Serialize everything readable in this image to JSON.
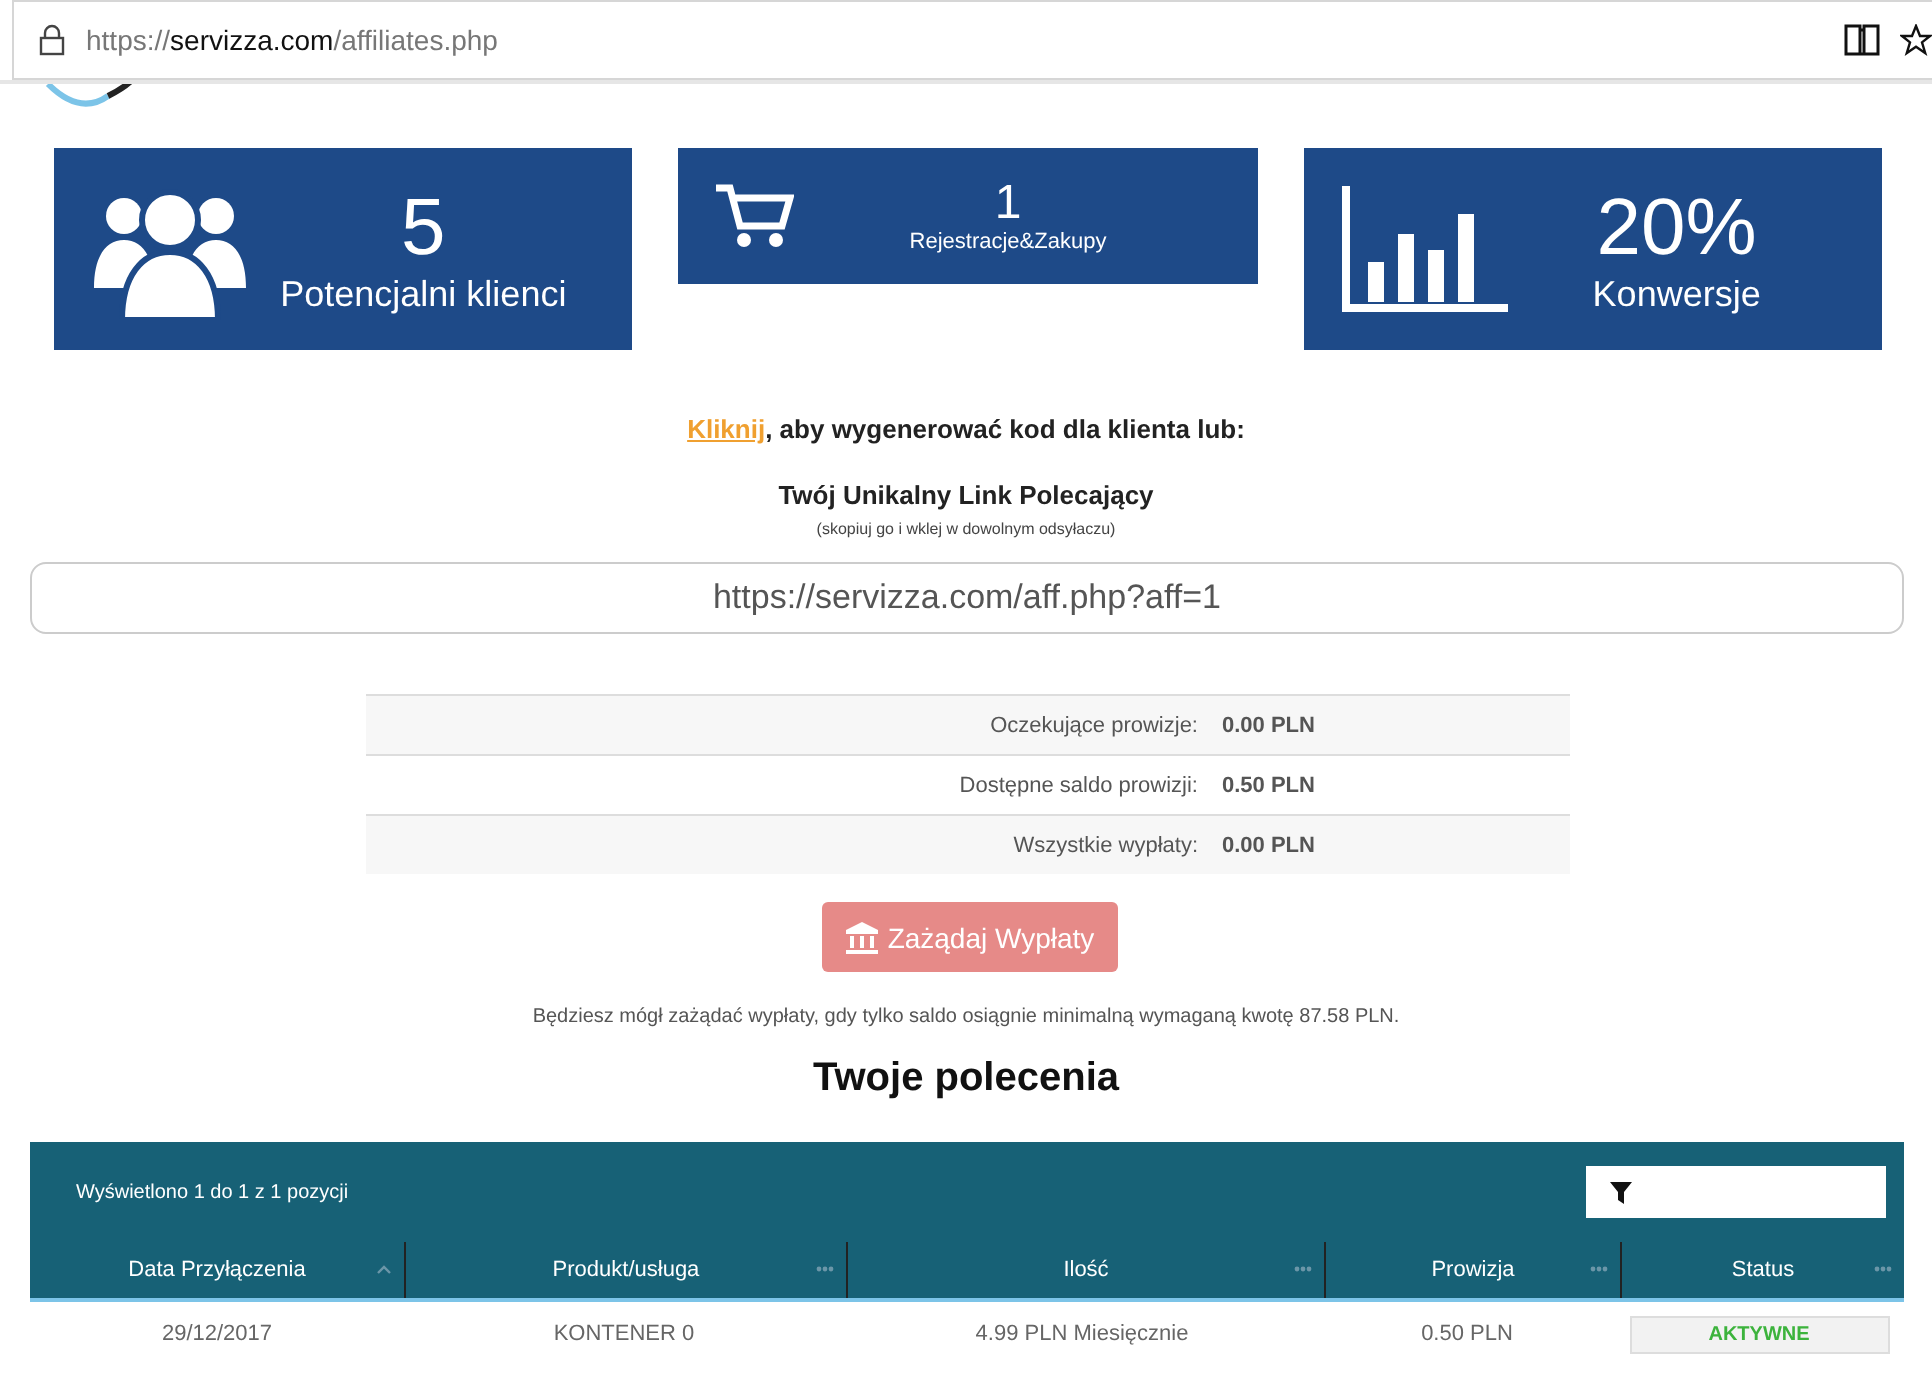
{
  "browser": {
    "url_scheme": "https://",
    "url_domain": "servizza.com",
    "url_path": "/affiliates.php"
  },
  "stats": [
    {
      "kind": "users",
      "value": "5",
      "label": "Potencjalni klienci",
      "compact": false
    },
    {
      "kind": "cart",
      "value": "1",
      "label": "Rejestracje&Zakupy",
      "compact": true
    },
    {
      "kind": "chart",
      "value": "20%",
      "label": "Konwersje",
      "compact": false
    }
  ],
  "intro": {
    "link": "Kliknij",
    "text": ", aby wygenerować kod dla klienta lub:"
  },
  "referral": {
    "title": "Twój Unikalny Link Polecający",
    "hint": "(skopiuj go i wklej w dowolnym odsyłaczu)",
    "link": "https://servizza.com/aff.php?aff=1"
  },
  "balances": [
    {
      "label": "Oczekujące prowizje:",
      "value": "0.00 PLN"
    },
    {
      "label": "Dostępne saldo prowizji:",
      "value": "0.50 PLN"
    },
    {
      "label": "Wszystkie wypłaty:",
      "value": "0.00 PLN"
    }
  ],
  "withdraw_button": {
    "label": "Zażądaj Wypłaty",
    "disabled": true
  },
  "note": "Będziesz mógł zażądać wypłaty, gdy tylko saldo osiągnie minimalną wymaganą kwotę 87.58 PLN.",
  "section_title": "Twoje polecenia",
  "table": {
    "info": "Wyświetlono 1 do 1 z 1 pozycji",
    "columns": [
      {
        "label": "Data Przyłączenia",
        "sorted": true
      },
      {
        "label": "Produkt/usługa",
        "sorted": false
      },
      {
        "label": "Ilość",
        "sorted": false
      },
      {
        "label": "Prowizja",
        "sorted": false
      },
      {
        "label": "Status",
        "sorted": false
      }
    ],
    "rows": [
      {
        "cells": [
          "29/12/2017",
          "KONTENER 0",
          "4.99 PLN Miesięcznie",
          "0.50 PLN"
        ],
        "status": "AKTYWNE",
        "active": true
      }
    ]
  }
}
